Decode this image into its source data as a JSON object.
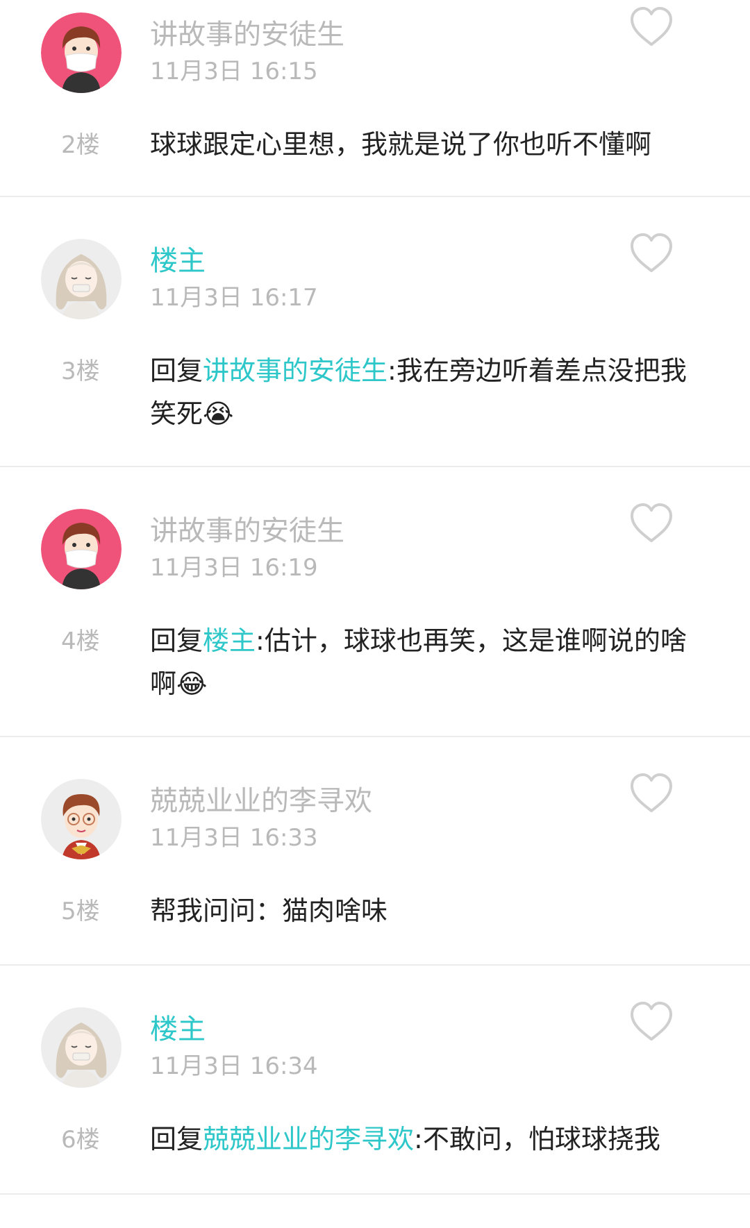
{
  "colors": {
    "accent": "#2dc7c9",
    "muted": "#b9b9b9",
    "text": "#222222",
    "divider": "#ececec"
  },
  "comments": [
    {
      "username": "讲故事的安徒生",
      "time": "11月3日 16:15",
      "floor": "2楼",
      "content": "球球跟定心里想，我就是说了你也听不懂啊",
      "avatar_icon": "masked-boy-avatar"
    },
    {
      "username": "楼主",
      "time": "11月3日 16:17",
      "floor": "3楼",
      "reply_prefix": "回复",
      "reply_to": "讲故事的安徒生",
      "content": ":我在旁边听着差点没把我笑死",
      "emoji": "😭",
      "avatar_icon": "white-hair-girl-avatar"
    },
    {
      "username": "讲故事的安徒生",
      "time": "11月3日 16:19",
      "floor": "4楼",
      "reply_prefix": "回复",
      "reply_to": "楼主",
      "content": ":估计，球球也再笑，这是谁啊说的啥啊",
      "emoji": "😂",
      "avatar_icon": "masked-boy-avatar"
    },
    {
      "username": "兢兢业业的李寻欢",
      "time": "11月3日 16:33",
      "floor": "5楼",
      "content": "帮我问问：猫肉啥味",
      "avatar_icon": "glasses-boy-avatar"
    },
    {
      "username": "楼主",
      "time": "11月3日 16:34",
      "floor": "6楼",
      "reply_prefix": "回复",
      "reply_to": "兢兢业业的李寻欢",
      "content": ":不敢问，怕球球挠我",
      "avatar_icon": "white-hair-girl-avatar"
    }
  ]
}
